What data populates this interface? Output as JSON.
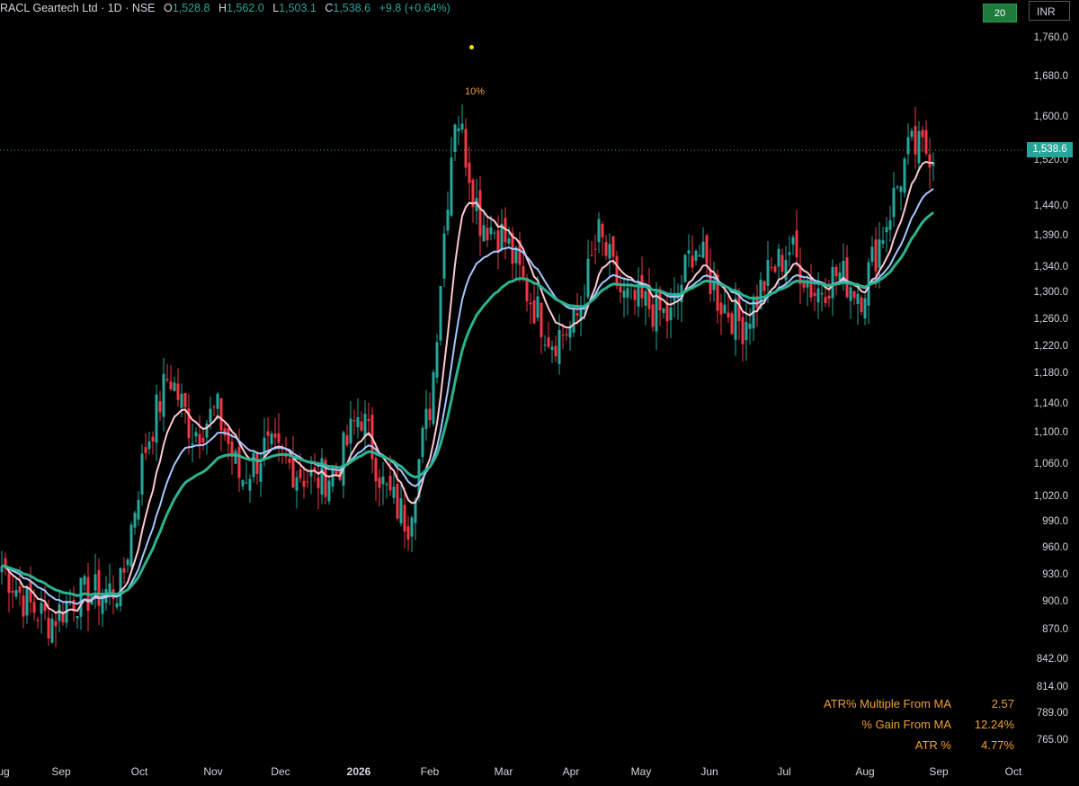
{
  "header": {
    "symbol": "RACL Geartech Ltd · 1D · NSE",
    "open_label": "O",
    "open": "1,528.8",
    "high_label": "H",
    "high": "1,562.0",
    "low_label": "L",
    "low": "1,503.1",
    "close_label": "C",
    "close": "1,538.6",
    "change": "+9.8 (+0.64%)"
  },
  "toolbar": {
    "period_button": "20",
    "currency_button": "INR"
  },
  "price_label": "1,538.6",
  "event_marker": {
    "label": "10%"
  },
  "stats": [
    {
      "label": "ATR% Multiple From MA",
      "value": "2.57"
    },
    {
      "label": "% Gain From MA",
      "value": "12.24%"
    },
    {
      "label": "ATR %",
      "value": "4.77%"
    }
  ],
  "chart_data": {
    "type": "candlestick",
    "y_axis_ticks": [
      "1,760.0",
      "1,680.0",
      "1,600.0",
      "1,520.0",
      "1,440.0",
      "1,390.0",
      "1,340.0",
      "1,300.0",
      "1,260.0",
      "1,220.0",
      "1,180.0",
      "1,140.0",
      "1,100.0",
      "1,060.0",
      "1,020.0",
      "990.0",
      "960.0",
      "930.0",
      "900.0",
      "870.0",
      "842.00",
      "814.00",
      "789.00",
      "765.00"
    ],
    "x_axis_ticks": [
      "Aug",
      "Sep",
      "Oct",
      "Nov",
      "Dec",
      "2026",
      "Feb",
      "Mar",
      "Apr",
      "May",
      "Jun",
      "Jul",
      "Aug",
      "Sep",
      "Oct"
    ],
    "y_scale": "log",
    "colors": {
      "up": "#26a69a",
      "down": "#f23645",
      "ma_fast": "#ffc8d2",
      "ma_mid": "#a7c7ff",
      "ma_slow": "#2bb38f",
      "grid": "none"
    },
    "series_close": [
      {
        "date": "Aug",
        "close": 940
      },
      {
        "date": "Aug-mid",
        "close": 900
      },
      {
        "date": "Aug-late",
        "close": 880
      },
      {
        "date": "Sep",
        "close": 905
      },
      {
        "date": "Sep-mid",
        "close": 910
      },
      {
        "date": "Sep-late",
        "close": 915
      },
      {
        "date": "Oct",
        "close": 1080
      },
      {
        "date": "Oct-mid",
        "close": 1180
      },
      {
        "date": "Oct-late",
        "close": 1100
      },
      {
        "date": "Nov",
        "close": 1130
      },
      {
        "date": "Nov-mid",
        "close": 1040
      },
      {
        "date": "Nov-late",
        "close": 1080
      },
      {
        "date": "Dec",
        "close": 1060
      },
      {
        "date": "Dec-mid",
        "close": 1040
      },
      {
        "date": "Dec-late",
        "close": 1050
      },
      {
        "date": "2026",
        "close": 1130
      },
      {
        "date": "Jan-mid",
        "close": 1030
      },
      {
        "date": "Jan-late",
        "close": 990
      },
      {
        "date": "Feb",
        "close": 1150
      },
      {
        "date": "Feb-mid",
        "close": 1620
      },
      {
        "date": "Feb-late",
        "close": 1420
      },
      {
        "date": "Mar",
        "close": 1390
      },
      {
        "date": "Mar-mid",
        "close": 1300
      },
      {
        "date": "Mar-late",
        "close": 1230
      },
      {
        "date": "Apr",
        "close": 1250
      },
      {
        "date": "Apr-mid",
        "close": 1390
      },
      {
        "date": "Apr-late",
        "close": 1290
      },
      {
        "date": "May",
        "close": 1280
      },
      {
        "date": "May-mid",
        "close": 1260
      },
      {
        "date": "May-late",
        "close": 1380
      },
      {
        "date": "Jun",
        "close": 1290
      },
      {
        "date": "Jun-mid",
        "close": 1250
      },
      {
        "date": "Jun-late",
        "close": 1320
      },
      {
        "date": "Jul",
        "close": 1370
      },
      {
        "date": "Jul-mid",
        "close": 1300
      },
      {
        "date": "Jul-late",
        "close": 1330
      },
      {
        "date": "Aug",
        "close": 1300
      },
      {
        "date": "Aug-mid",
        "close": 1410
      },
      {
        "date": "Aug-late",
        "close": 1540
      },
      {
        "date": "Sep",
        "close": 1538.6
      }
    ]
  }
}
